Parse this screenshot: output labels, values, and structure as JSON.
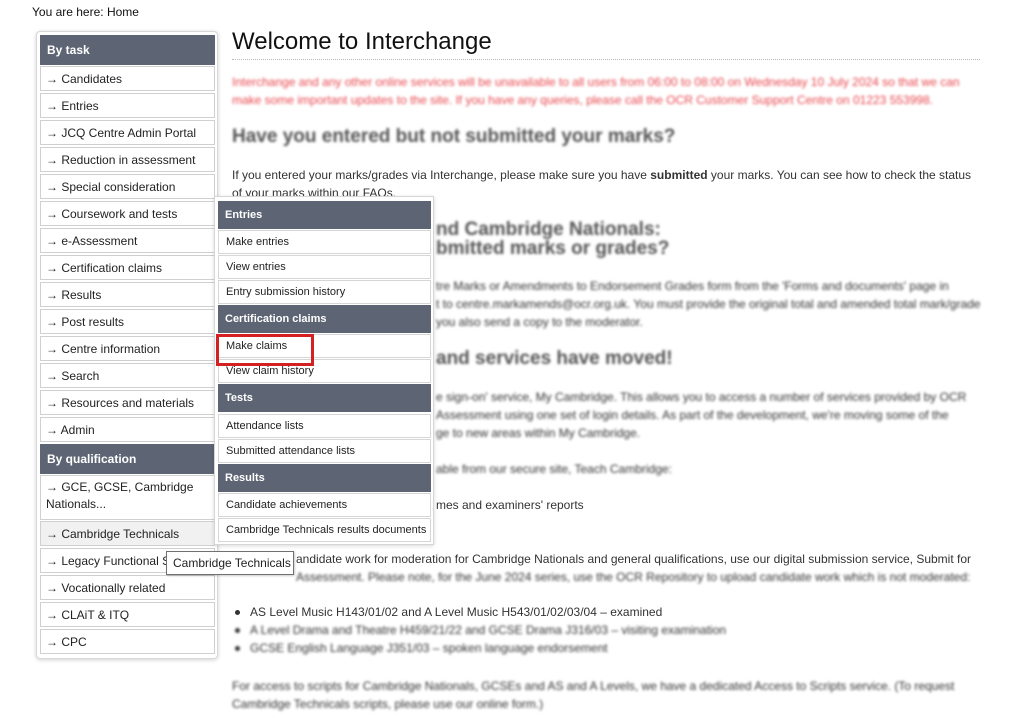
{
  "breadcrumb": "You are here: Home",
  "nav": {
    "by_task_heading": "By task",
    "by_task": [
      "→ Candidates",
      "→ Entries",
      "→ JCQ Centre Admin Portal",
      "→ Reduction in assessment",
      "→ Special consideration",
      "→ Coursework and tests",
      "→ e-Assessment",
      "→ Certification claims",
      "→ Results",
      "→ Post results",
      "→ Centre information",
      "→ Search",
      "→ Resources and materials",
      "→ Admin"
    ],
    "by_qualification_heading": "By qualification",
    "by_qualification": [
      "→ GCE, GCSE, Cambridge Nationals...",
      "→ Cambridge Technicals",
      "→ Legacy Functional Skills",
      "→ Vocationally related",
      "→ CLAiT & ITQ",
      "→ CPC"
    ]
  },
  "dropdown": {
    "entries_heading": "Entries",
    "entries": [
      "Make entries",
      "View entries",
      "Entry submission history"
    ],
    "cert_heading": "Certification claims",
    "cert": [
      "Make claims",
      "View claim history"
    ],
    "tests_heading": "Tests",
    "tests": [
      "Attendance lists",
      "Submitted attendance lists"
    ],
    "results_heading": "Results",
    "results": [
      "Candidate achievements",
      "Cambridge Technicals results documents"
    ]
  },
  "tooltip": "Cambridge Technicals",
  "main": {
    "title": "Welcome to Interchange",
    "notice": "Interchange and any other online services will be unavailable to all users from 06:00 to 08:00 on Wednesday 10 July 2024 so that we can make some important updates to the site. If you have any queries, please call the OCR Customer Support Centre on 01223 553998.",
    "h_marks": "Have you entered but not submitted your marks?",
    "p_marks_1": "If you entered your marks/grades via Interchange, please make sure you have ",
    "p_marks_bold": "submitted",
    "p_marks_2": " your marks. You can see how to check the status of your marks within our FAQs.",
    "h_nationals_1": "nd Cambridge Nationals:",
    "h_nationals_2": "bmitted marks or grades?",
    "p_amend_1": "tre Marks or Amendments to Endorsement Grades form from the 'Forms and documents' page in",
    "p_amend_2": "t to centre.markamends@ocr.org.uk. You must provide the original total and amended total mark/grade",
    "p_amend_3": "you also send a copy to the moderator.",
    "h_moved": "and services have moved!",
    "p_mc_1": "e sign-on' service, My Cambridge. This allows you to access a number of services provided by OCR",
    "p_mc_2": "Assessment using one set of login details. As part of the development, we're moving some of the",
    "p_mc_3": "ge to new areas within My Cambridge.",
    "p_teach": "able from our secure site, Teach Cambridge:",
    "p_schemes": "mes and examiners' reports",
    "p_submit_1": "andidate work for moderation for Cambridge Nationals and general qualifications, use our digital submission service, Submit for",
    "p_submit_2": "Assessment. Please note, for the June 2024 series, use the OCR Repository to upload candidate work which is not moderated:",
    "bullets": [
      "AS Level Music H143/01/02 and A Level Music H543/01/02/03/04 – examined",
      "A Level Drama and Theatre H459/21/22 and GCSE Drama J316/03 – visiting examination",
      "GCSE English Language J351/03 – spoken language endorsement"
    ],
    "p_scripts_1": "For access to scripts for Cambridge Nationals, GCSEs and AS and A Levels, we have a dedicated Access to Scripts service. (To request",
    "p_scripts_2": "Cambridge Technicals scripts, please use our online form.)"
  }
}
